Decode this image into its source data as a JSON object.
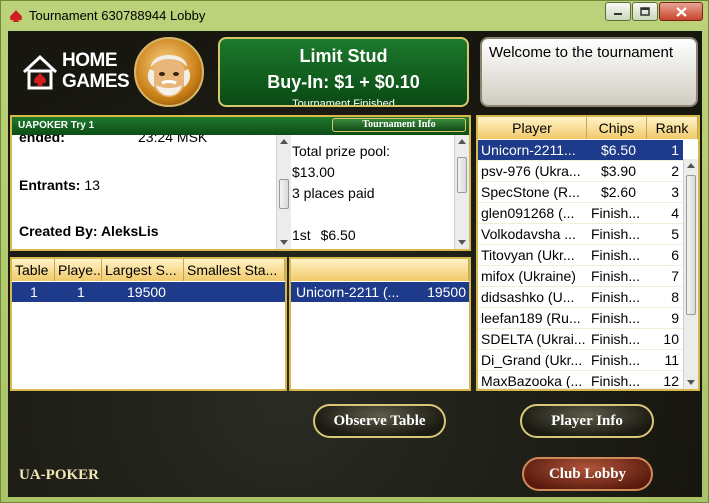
{
  "window": {
    "title": "Tournament 630788944 Lobby"
  },
  "branding": {
    "logo_line1": "HOME",
    "logo_line2": "GAMES",
    "footer": "UA-POKER"
  },
  "banner": {
    "game": "Limit Stud",
    "buyin": "Buy-In: $1 + $0.10",
    "status": "Tournament Finished"
  },
  "welcome": "Welcome to the tournament",
  "details": {
    "header": "UAPOKER Try 1",
    "tournament_info_label": "Tournament Info",
    "ended_label": "ended:",
    "ended_value": "23:24 MSK",
    "entrants_label": "Entrants:",
    "entrants_value": "13",
    "created_by": "Created By: AleksLis",
    "prize_pool_label": "Total prize pool:",
    "prize_pool_value": "$13.00",
    "places_paid": "3 places paid",
    "first_place": "1st",
    "first_amount": "$6.50"
  },
  "tables_list": {
    "headers": [
      "Table",
      "Playe...",
      "Largest S...",
      "Smallest Sta..."
    ],
    "rows": [
      {
        "table": "1",
        "players": "1",
        "largest": "19500",
        "smallest": ""
      }
    ]
  },
  "table_players": {
    "rows": [
      {
        "name": "Unicorn-2211 (...",
        "chips": "19500"
      }
    ]
  },
  "standings": {
    "headers": [
      "Player",
      "Chips",
      "Rank"
    ],
    "rows": [
      {
        "player": "Unicorn-2211...",
        "chips": "$6.50",
        "rank": "1"
      },
      {
        "player": "psv-976 (Ukra...",
        "chips": "$3.90",
        "rank": "2"
      },
      {
        "player": "SpecStone (R...",
        "chips": "$2.60",
        "rank": "3"
      },
      {
        "player": "glen091268 (...",
        "chips": "Finish...",
        "rank": "4"
      },
      {
        "player": "Volkodavsha ...",
        "chips": "Finish...",
        "rank": "5"
      },
      {
        "player": "Titovyan (Ukr...",
        "chips": "Finish...",
        "rank": "6"
      },
      {
        "player": "mifox (Ukraine)",
        "chips": "Finish...",
        "rank": "7"
      },
      {
        "player": "didsashko (U...",
        "chips": "Finish...",
        "rank": "8"
      },
      {
        "player": "leefan189 (Ru...",
        "chips": "Finish...",
        "rank": "9"
      },
      {
        "player": "SDELTA (Ukrai...",
        "chips": "Finish...",
        "rank": "10"
      },
      {
        "player": "Di_Grand (Ukr...",
        "chips": "Finish...",
        "rank": "11"
      },
      {
        "player": "MaxBazooka (...",
        "chips": "Finish...",
        "rank": "12"
      }
    ]
  },
  "buttons": {
    "observe_table": "Observe Table",
    "player_info": "Player Info",
    "club_lobby": "Club Lobby"
  }
}
